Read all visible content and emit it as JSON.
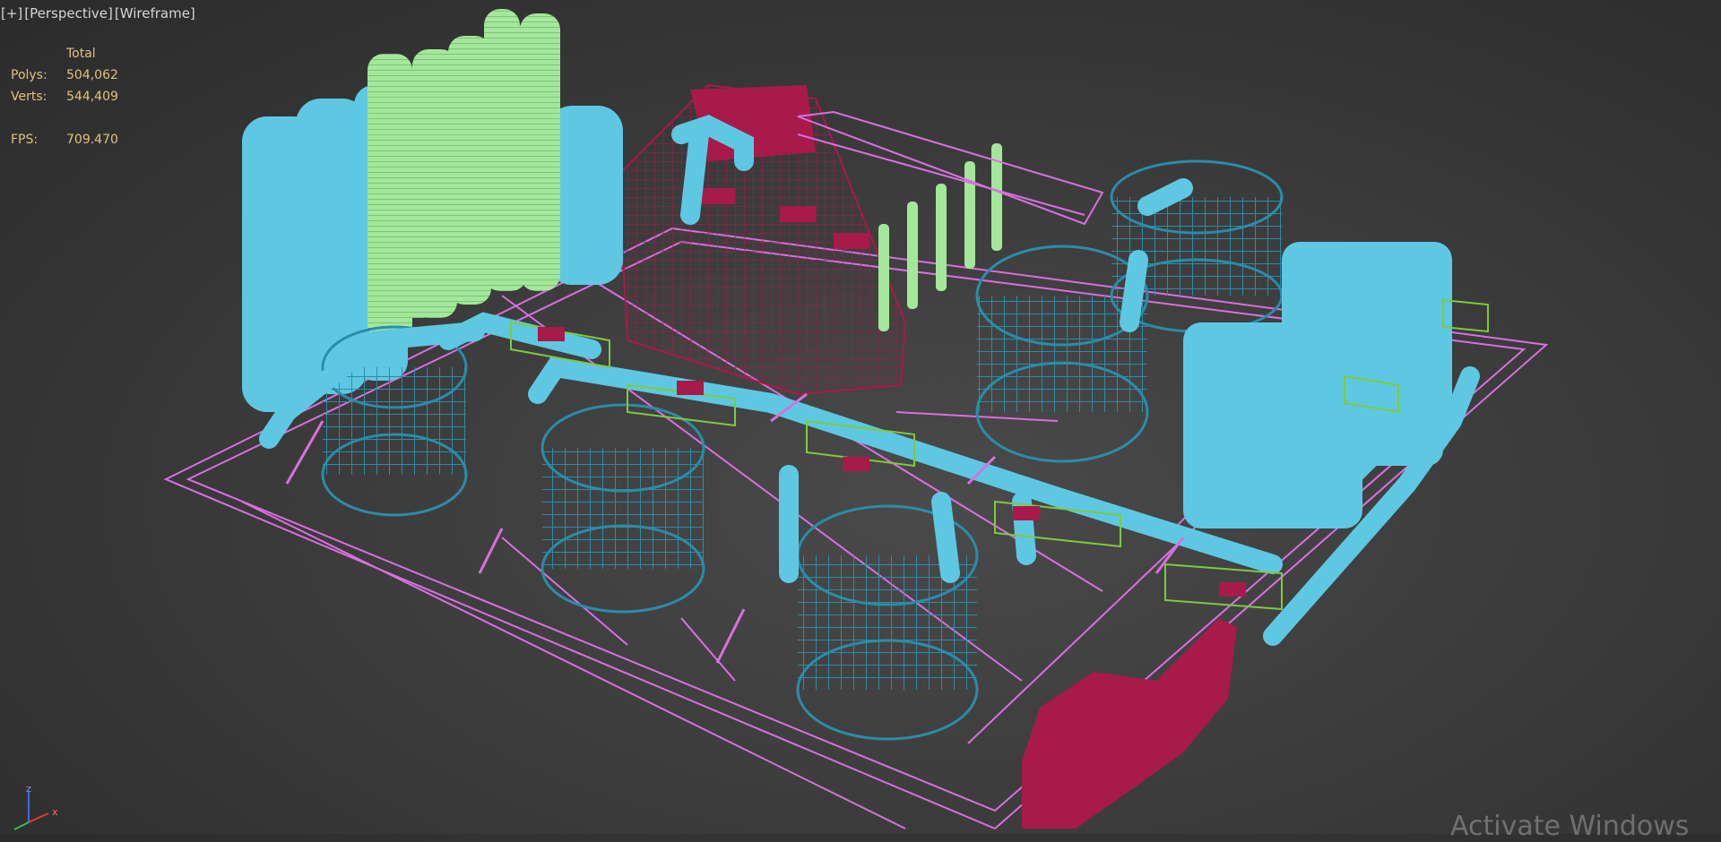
{
  "viewport": {
    "labels": [
      "[+]",
      "[Perspective]",
      "[Wireframe]"
    ]
  },
  "stats": {
    "header": "Total",
    "polys_label": "Polys:",
    "polys_value": "504,062",
    "verts_label": "Verts:",
    "verts_value": "544,409",
    "fps_label": "FPS:",
    "fps_value": "709.470"
  },
  "scene": {
    "description": "wireframe industrial plant model",
    "colors": {
      "background": "#3a3a3a",
      "pipes_light_blue": "#5ec8e2",
      "tanks_teal": "#2a8da8",
      "towers_green": "#a3e89a",
      "building_crimson": "#a81a4a",
      "frame_magenta": "#d870e0",
      "rails_green": "#7ecb3d",
      "stats_text": "#e0c37a"
    }
  },
  "gizmo": {
    "axes": [
      "z",
      "x"
    ],
    "axis_icon": "axis-gizmo-icon"
  },
  "watermark": {
    "text": "Activate Windows"
  }
}
